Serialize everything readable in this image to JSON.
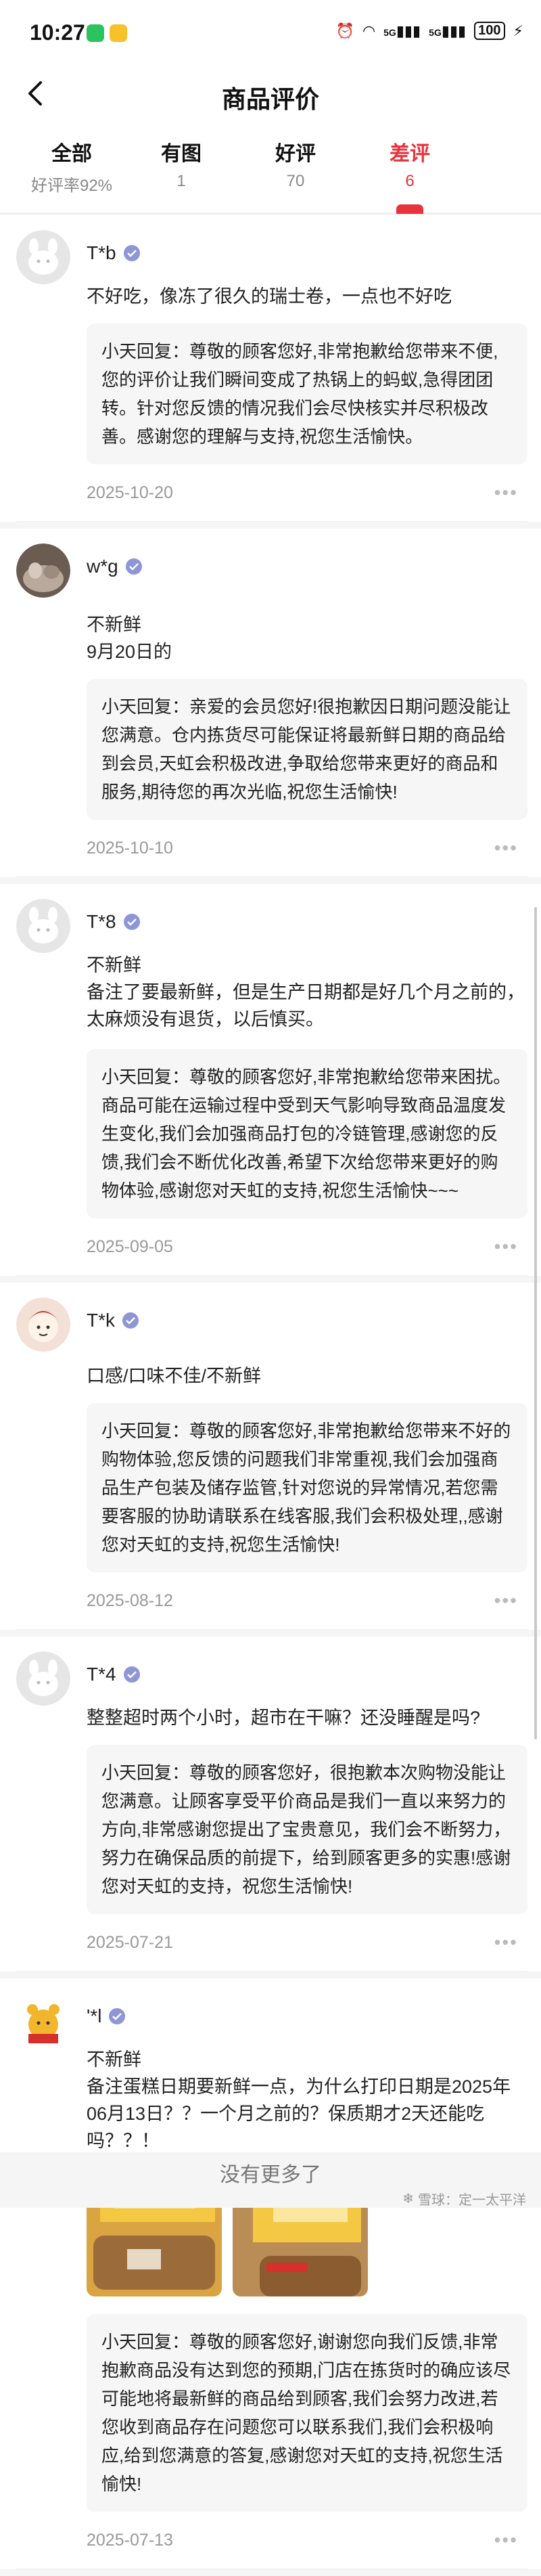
{
  "status_bar": {
    "time": "10:27",
    "signal1": "5G",
    "signal2": "5G",
    "battery": "100"
  },
  "header": {
    "title": "商品评价"
  },
  "tabs": [
    {
      "label": "全部",
      "sub": "好评率92%"
    },
    {
      "label": "有图",
      "sub": "1"
    },
    {
      "label": "好评",
      "sub": "70"
    },
    {
      "label": "差评",
      "sub": "6",
      "active": true
    }
  ],
  "reviews": [
    {
      "user": "T*b",
      "text": "不好吃，像冻了很久的瑞士卷，一点也不好吃",
      "reply": "小天回复：尊敬的顾客您好,非常抱歉给您带来不便,您的评价让我们瞬间变成了热锅上的蚂蚁,急得团团转。针对您反馈的情况我们会尽快核实并尽积极改善。感谢您的理解与支持,祝您生活愉快。",
      "date": "2025-10-20"
    },
    {
      "user": "w*g",
      "text": "不新鲜\n9月20日的",
      "reply": "小天回复：亲爱的会员您好!很抱歉因日期问题没能让您满意。仓内拣货尽可能保证将最新鲜日期的商品给到会员,天虹会积极改进,争取给您带来更好的商品和服务,期待您的再次光临,祝您生活愉快!",
      "date": "2025-10-10"
    },
    {
      "user": "T*8",
      "text": "不新鲜\n备注了要最新鲜，但是生产日期都是好几个月之前的，太麻烦没有退货，以后慎买。",
      "reply": "小天回复：尊敬的顾客您好,非常抱歉给您带来困扰。商品可能在运输过程中受到天气影响导致商品温度发生变化,我们会加强商品打包的冷链管理,感谢您的反馈,我们会不断优化改善,希望下次给您带来更好的购物体验,感谢您对天虹的支持,祝您生活愉快~~~",
      "date": "2025-09-05"
    },
    {
      "user": "T*k",
      "text": "口感/口味不佳/不新鲜",
      "reply": "小天回复：尊敬的顾客您好,非常抱歉给您带来不好的购物体验,您反馈的问题我们非常重视,我们会加强商品生产包装及储存监管,针对您说的异常情况,若您需要客服的协助请联系在线客服,我们会积极处理,,感谢您对天虹的支持,祝您生活愉快!",
      "date": "2025-08-12"
    },
    {
      "user": "T*4",
      "text": "整整超时两个小时，超市在干嘛？还没睡醒是吗?",
      "reply": "小天回复：尊敬的顾客您好，很抱歉本次购物没能让您满意。让顾客享受平价商品是我们一直以来努力的方向,非常感谢您提出了宝贵意见，我们会不断努力，努力在确保品质的前提下，给到顾客更多的实惠!感谢您对天虹的支持，祝您生活愉快!",
      "date": "2025-07-21"
    },
    {
      "user": "'*l",
      "text": "不新鲜\n备注蛋糕日期要新鲜一点，为什么打印日期是2025年06月13日？？一个月之前的？保质期才2天还能吃吗？？！",
      "reply": "小天回复：尊敬的顾客您好,谢谢您向我们反馈,非常抱歉商品没有达到您的预期,门店在拣货时的确应该尽可能地将最新鲜的商品给到顾客,我们会努力改进,若您收到商品存在问题您可以联系我们,我们会积极响应,给到您满意的答复,感谢您对天虹的支持,祝您生活愉快!",
      "date": "2025-07-13"
    }
  ],
  "footer": {
    "no_more": "没有更多了",
    "watermark": "雪球：定一太平洋"
  },
  "colors": {
    "accent": "#e8323c",
    "badge": "#8f96d6"
  },
  "icons": [
    "back-arrow-icon",
    "verified-badge-icon",
    "more-dots-icon",
    "wechat-icon",
    "app-icon",
    "alarm-icon",
    "wifi-icon",
    "signal-icon",
    "battery-icon"
  ]
}
